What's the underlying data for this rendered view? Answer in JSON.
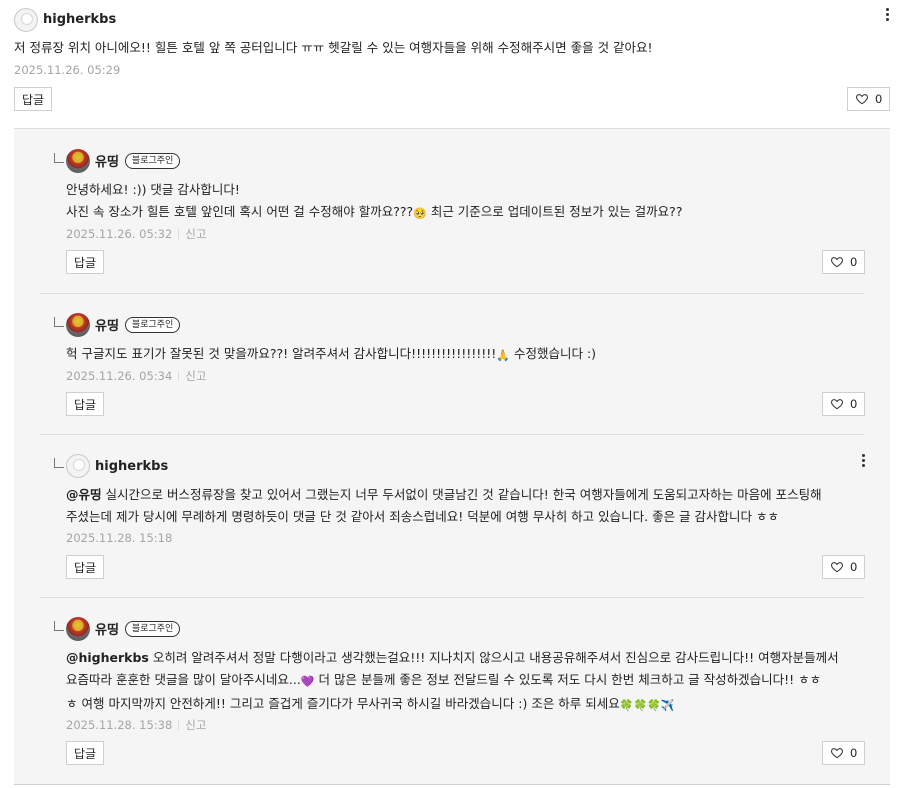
{
  "main_comment": {
    "author": "higherkbs",
    "text": "저 정류장 위치 아니에오!! 힐튼 호텔 앞 쪽 공터입니다 ㅠㅠ 헷갈릴 수 있는 여행자들을 위해 수정해주시면 좋을 것 같아요!",
    "date": "2025.11.26. 05:29",
    "reply_label": "답글",
    "like_count": "0"
  },
  "replies": [
    {
      "author": "유띵",
      "badge": "블로그주인",
      "line1": "안녕하세요! :)) 댓글 감사합니다!",
      "line2_a": "사진 속 장소가 힐튼 호텔 앞인데 혹시 어떤 걸 수정해야 할까요???",
      "line2_b": " 최근 기준으로 업데이트된 정보가 있는 걸까요??",
      "date": "2025.11.26. 05:32",
      "report": "신고",
      "reply_label": "답글",
      "like_count": "0"
    },
    {
      "author": "유띵",
      "badge": "블로그주인",
      "line1_a": "헉 구글지도 표기가 잘못된 것 맞을까요??! 알려주셔서 감사합니다!!!!!!!!!!!!!!!!!",
      "line1_b": " 수정했습니다 :)",
      "date": "2025.11.26. 05:34",
      "report": "신고",
      "reply_label": "답글",
      "like_count": "0"
    },
    {
      "author": "higherkbs",
      "mention": "@유띵",
      "line1": " 실시간으로 버스정류장을 찾고 있어서 그랬는지 너무 두서없이 댓글남긴 것 같습니다! 한국 여행자들에게 도움되고자하는 마음에 포스팅해",
      "line2": "주셨는데 제가 당시에 무례하게 명령하듯이 댓글 단 것 같아서 죄송스럽네요! 덕분에 여행 무사히 하고 있습니다. 좋은 글 감사합니다 ㅎㅎ",
      "date": "2025.11.28. 15:18",
      "reply_label": "답글",
      "like_count": "0"
    },
    {
      "author": "유띵",
      "badge": "블로그주인",
      "mention": "@higherkbs",
      "line1": " 오히려 알려주셔서 정말 다행이라고 생각했는걸요!!! 지나치지 않으시고 내용공유해주셔서 진심으로 감사드립니다!! 여행자분들께서",
      "line2_a": "요즘따라 훈훈한 댓글을 많이 달아주시네요...",
      "line2_b": " 더 많은 분들께 좋은 정보 전달드릴 수 있도록 저도 다시 한번 체크하고 글 작성하겠습니다!! ㅎㅎ",
      "line3_a": "ㅎ 여행 마지막까지 안전하게!! 그리고 즐겁게 즐기다가 무사귀국 하시길 바라겠습니다 :) 조은 하루 되세요",
      "date": "2025.11.28. 15:38",
      "report": "신고",
      "reply_label": "답글",
      "like_count": "0"
    }
  ],
  "icons": {
    "more": "more-vertical-icon",
    "heart": "heart-outline-icon",
    "reply_corner": "reply-corner-icon",
    "emojis": [
      "pleading-face-emoji",
      "praying-hands-emoji",
      "purple-heart-emoji",
      "clover-emoji",
      "airplane-emoji"
    ]
  }
}
